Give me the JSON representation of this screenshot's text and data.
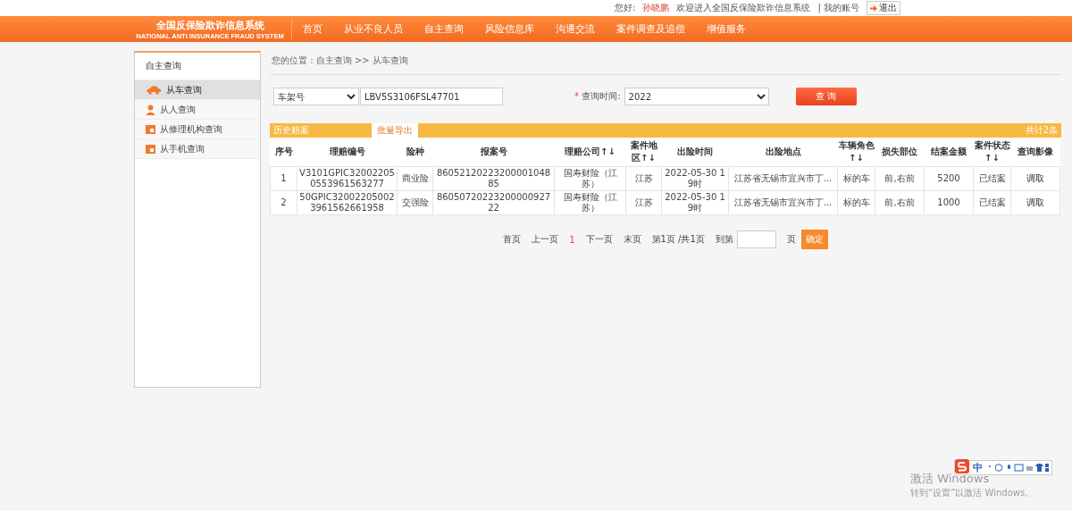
{
  "top_bar": {
    "greeting": "您好:",
    "user": "孙晓鹏",
    "welcome": "欢迎进入全国反保险欺诈信息系统",
    "account": "| 我的账号",
    "logout": "退出"
  },
  "nav": {
    "logo_cn": "全国反保险欺诈信息系统",
    "logo_en": "NATIONAL ANTI INSURANCE FRAUD SYSTEM",
    "items": [
      {
        "label": "首页",
        "selected": false
      },
      {
        "label": "从业不良人员",
        "selected": false
      },
      {
        "label": "自主查询",
        "selected": false
      },
      {
        "label": "风险信息库",
        "selected": false
      },
      {
        "label": "沟通交流",
        "selected": false
      },
      {
        "label": "案件调查及追偿",
        "selected": false
      },
      {
        "label": "增值服务",
        "selected": false
      }
    ]
  },
  "sidebar": {
    "title": "自主查询",
    "items": [
      {
        "label": "从车查询",
        "kind": "car",
        "selected": true
      },
      {
        "label": "从人查询",
        "kind": "person",
        "selected": false
      },
      {
        "label": "从修理机构查询",
        "kind": "calendar",
        "selected": false
      },
      {
        "label": "从手机查询",
        "kind": "calendar",
        "selected": false
      }
    ]
  },
  "breadcrumb": "您的位置 : 自主查询 >> 从车查询",
  "search": {
    "field_type": "车架号",
    "value": "LBV5S3106FSL47701",
    "required_mark": "*",
    "time_label": "查询时间:",
    "time_value": "2022",
    "button": "查 询"
  },
  "table": {
    "title": "历史赔案",
    "export": "批量导出",
    "total": "共计2条",
    "columns": [
      "序号",
      "理赔编号",
      "险种",
      "报案号",
      "理赔公司↑↓",
      "案件地区↑↓",
      "出险时间",
      "出险地点",
      "车辆角色↑↓",
      "损失部位",
      "结案金额",
      "案件状态↑↓",
      "查询影像"
    ],
    "rows": [
      [
        "1",
        "V3101GPIC320022050553961563277",
        "商业险",
        "8605212022320000104885",
        "国寿财险（江苏）",
        "江苏",
        "2022-05-30 19时",
        "江苏省无锡市宜兴市丁...",
        "标的车",
        "前,右前",
        "5200",
        "已结案",
        "调取"
      ],
      [
        "2",
        "50GPIC320022050023961562661958",
        "交强险",
        "8605072022320000092722",
        "国寿财险（江苏）",
        "江苏",
        "2022-05-30 19时",
        "江苏省无锡市宜兴市丁...",
        "标的车",
        "前,右前",
        "1000",
        "已结案",
        "调取"
      ]
    ]
  },
  "pagination": {
    "first": "首页",
    "prev": "上一页",
    "current": "1",
    "next": "下一页",
    "last": "末页",
    "info": "第1页 /共1页",
    "goto": "到第",
    "page_unit": "页",
    "confirm": "确定"
  },
  "windows_notice": {
    "title": "激活 Windows",
    "text": "转到“设置”以激活 Windows。"
  },
  "ime_bar": {
    "mode": "中"
  }
}
